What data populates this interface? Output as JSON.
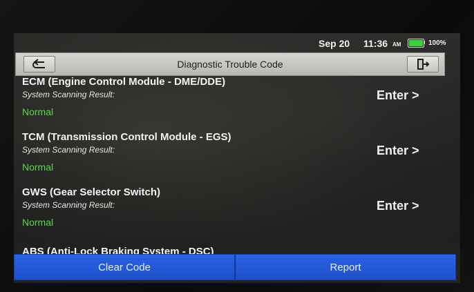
{
  "status_bar": {
    "date": "Sep 20",
    "time": "11:36",
    "ampm": "AM",
    "battery_percent_label": "100%",
    "battery_level": 1.0,
    "battery_color": "#3ad33a"
  },
  "header": {
    "title": "Diagnostic Trouble Code",
    "back_icon": "back-arrow-icon",
    "exit_icon": "exit-door-icon"
  },
  "modules": [
    {
      "name": "ECM (Engine Control Module - DME/DDE)",
      "subtitle": "System Scanning Result:",
      "status": "Normal",
      "enter_label": "Enter >"
    },
    {
      "name": "TCM (Transmission Control Module - EGS)",
      "subtitle": "System Scanning Result:",
      "status": "Normal",
      "enter_label": "Enter >"
    },
    {
      "name": "GWS (Gear Selector Switch)",
      "subtitle": "System Scanning Result:",
      "status": "Normal",
      "enter_label": "Enter >"
    }
  ],
  "partial_module": {
    "name": "ABS (Anti-Lock Braking System - DSC)"
  },
  "footer": {
    "clear_label": "Clear Code",
    "report_label": "Report"
  },
  "colors": {
    "status_normal": "#62d24a",
    "button_blue": "#2a63e6"
  }
}
